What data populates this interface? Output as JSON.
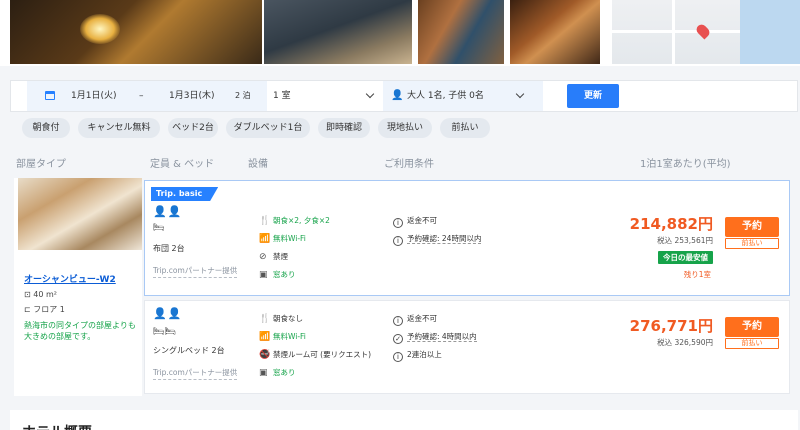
{
  "search": {
    "checkin": "1月1日(火)",
    "separator": "–",
    "checkout": "1月3日(木)",
    "nights": "2 泊",
    "rooms": "1 室",
    "guests": "大人 1名, 子供 0名",
    "update_label": "更新"
  },
  "filters": [
    "朝食付",
    "キャンセル無料",
    "ベッド2台",
    "ダブルベッド1台",
    "即時確認",
    "現地払い",
    "前払い"
  ],
  "table_header": {
    "room_type": "部屋タイプ",
    "capacity_bed": "定員 & ベッド",
    "facilities": "設備",
    "conditions": "ご利用条件",
    "price_per_night": "1泊1室あたり(平均)"
  },
  "room": {
    "name": "オーシャンビュー-W2",
    "area": "40 m²",
    "floor": "フロア 1",
    "note": "熱海市の同タイプの部屋よりも大きめの部屋です。"
  },
  "rates": [
    {
      "tag": "Trip. basic",
      "persons": "👤👤",
      "bed_icon": "🛏",
      "bed": "布団 2台",
      "partner": "Trip.comパートナー提供",
      "facilities": [
        {
          "icon": "meal-icon",
          "glyph": "🍴",
          "text": "朝食×2, 夕食×2",
          "green": true
        },
        {
          "icon": "wifi-icon",
          "glyph": "📶",
          "text": "無料Wi-Fi",
          "green": true
        },
        {
          "icon": "no-smoking-icon",
          "glyph": "⊘",
          "text": "禁煙",
          "green": false
        },
        {
          "icon": "parking-icon",
          "glyph": "▣",
          "text": "窓あり",
          "green": true
        }
      ],
      "conditions": [
        "返金不可",
        "予約確認: 24時間以内"
      ],
      "price": "214,882円",
      "tax_included": "税込 253,561円",
      "badge": "今日の最安値",
      "remaining": "残り1室",
      "book_label": "予約",
      "later_label": "前払い"
    },
    {
      "persons": "👤👤",
      "bed_icon": "🛏🛏",
      "bed": "シングルベッド 2台",
      "partner": "Trip.comパートナー提供",
      "facilities": [
        {
          "icon": "meal-icon",
          "glyph": "🍴",
          "text": "朝食なし",
          "green": false
        },
        {
          "icon": "wifi-icon",
          "glyph": "📶",
          "text": "無料Wi-Fi",
          "green": true
        },
        {
          "icon": "smoking-room-icon",
          "glyph": "🚭",
          "text": "禁煙ルーム可 (要リクエスト)",
          "green": false
        },
        {
          "icon": "window-icon",
          "glyph": "▣",
          "text": "窓あり",
          "green": true
        }
      ],
      "conditions": [
        "返金不可",
        "予約確認: 4時間以内",
        "2連泊以上"
      ],
      "price": "276,771円",
      "tax_included": "税込 326,590円",
      "book_label": "予約",
      "later_label": "前払い"
    }
  ],
  "section": {
    "overview_title": "ホテル概要"
  },
  "colors": {
    "accent": "#287dfa",
    "price": "#f05a22",
    "book": "#ff6f1c",
    "green": "#16a34a"
  }
}
